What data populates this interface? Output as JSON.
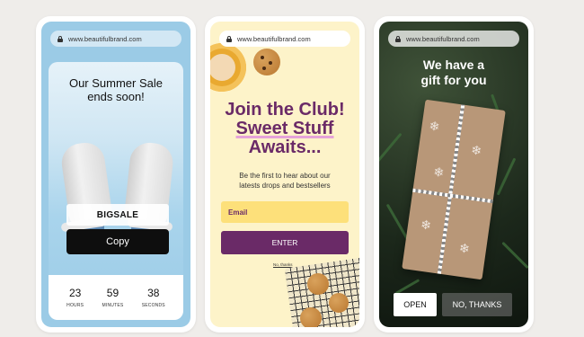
{
  "url": "www.beautifulbrand.com",
  "phone1": {
    "title_line1": "Our Summer Sale",
    "title_line2": "ends soon!",
    "coupon_code": "BIGSALE",
    "copy_label": "Copy",
    "timer": [
      {
        "value": "23",
        "label": "HOURS"
      },
      {
        "value": "59",
        "label": "MINUTES"
      },
      {
        "value": "38",
        "label": "SECONDS"
      }
    ]
  },
  "phone2": {
    "title_line1": "Join the Club!",
    "title_line2": "Sweet Stuff",
    "title_line3": "Awaits...",
    "subtitle_line1": "Be the first to hear about our",
    "subtitle_line2": "latests drops and bestsellers",
    "email_placeholder": "Email",
    "enter_label": "ENTER",
    "no_thanks_label": "No, thanks"
  },
  "phone3": {
    "title_line1": "We have a",
    "title_line2": "gift for you",
    "open_label": "OPEN",
    "no_thanks_label": "NO, THANKS"
  },
  "colors": {
    "sale_bg": "#9bcbe6",
    "club_bg": "#fdf3c9",
    "club_purple": "#6a2a67",
    "club_yellow": "#fde07a",
    "gift_bg": "#1c281b"
  }
}
